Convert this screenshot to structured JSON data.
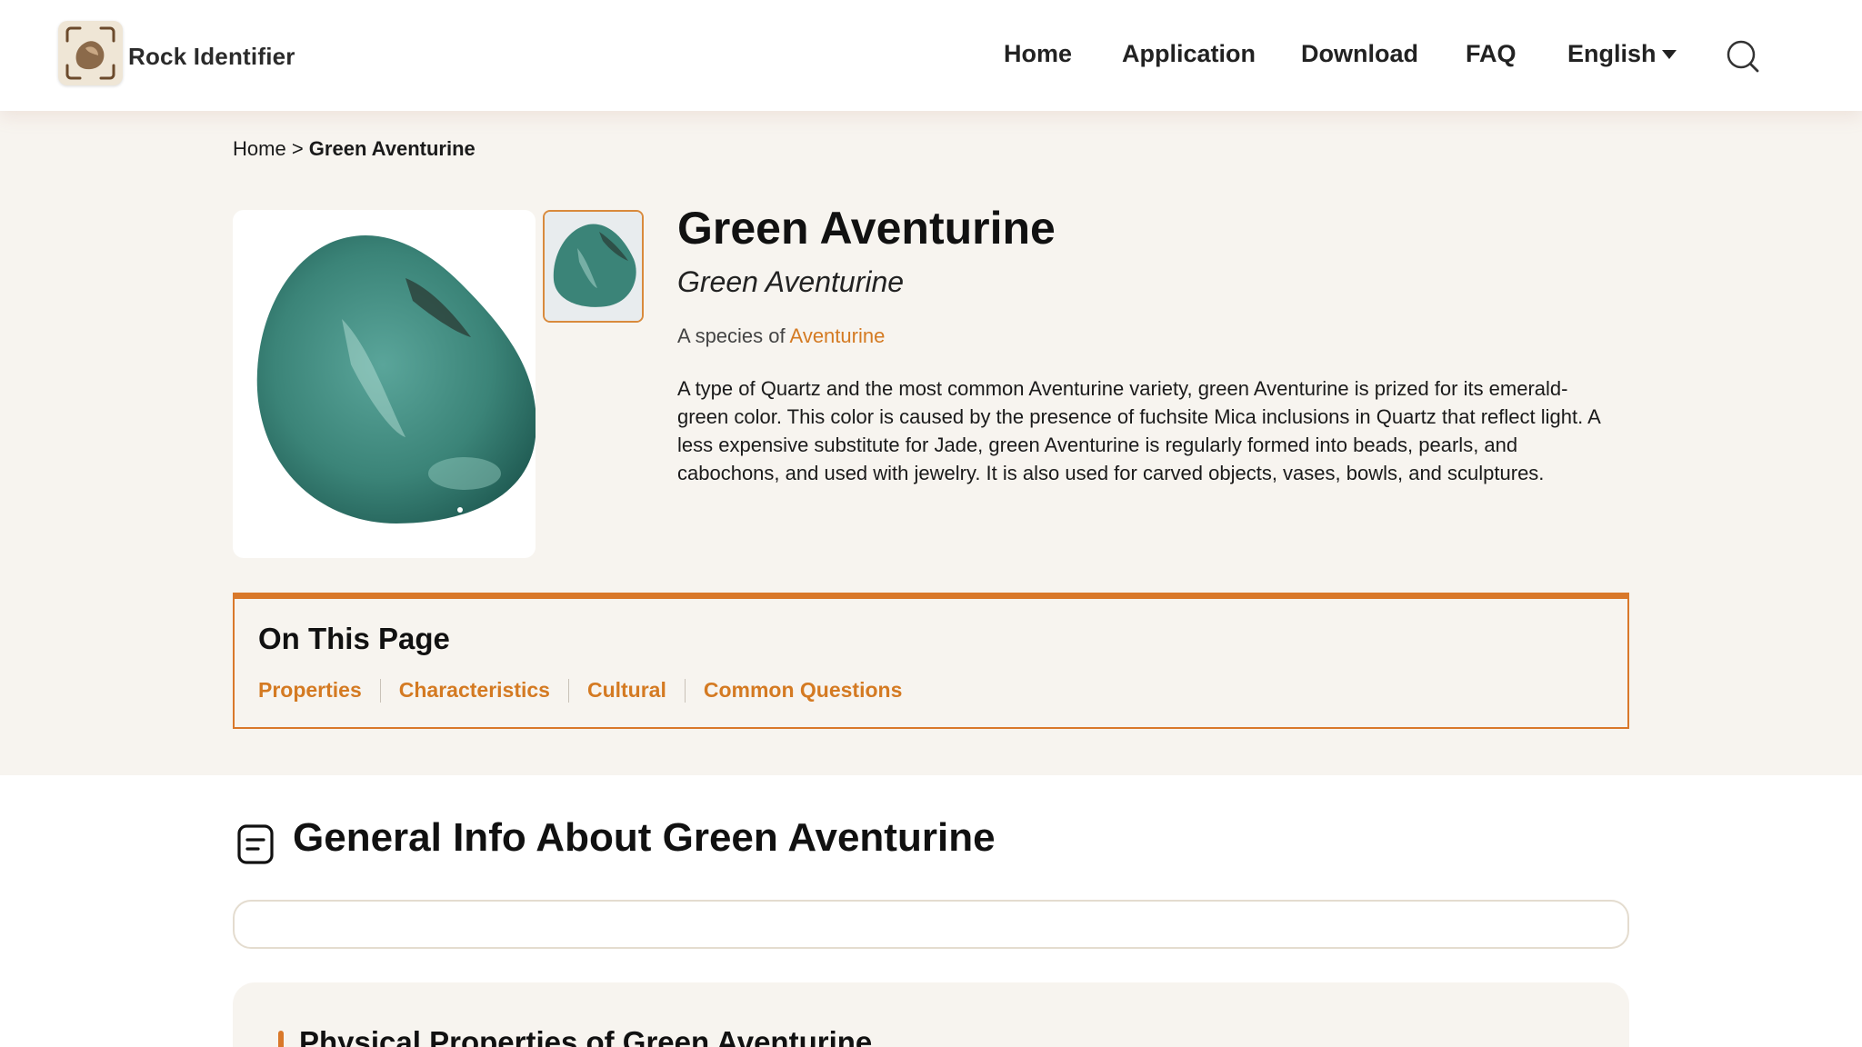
{
  "header": {
    "brand": "Rock Identifier",
    "nav": {
      "home": "Home",
      "application": "Application",
      "download": "Download",
      "faq": "FAQ",
      "language": "English"
    }
  },
  "breadcrumb": {
    "home": "Home",
    "separator": ">",
    "current": "Green Aventurine"
  },
  "specimen": {
    "title": "Green Aventurine",
    "subtitle": "Green Aventurine",
    "species_prefix": "A species of",
    "species_link": "Aventurine",
    "description": "A type of Quartz and the most common Aventurine variety, green Aventurine is prized for its emerald-green color. This color is caused by the presence of fuchsite Mica inclusions in Quartz that reflect light. A less expensive substitute for Jade, green Aventurine is regularly formed into beads, pearls, and cabochons, and used with jewelry. It is also used for carved objects, vases, bowls, and sculptures."
  },
  "toc": {
    "title": "On This Page",
    "links": [
      "Properties",
      "Characteristics",
      "Cultural",
      "Common Questions"
    ]
  },
  "general": {
    "title": "General Info About Green Aventurine"
  },
  "physical": {
    "title": "Physical Properties of Green Aventurine"
  },
  "colors": {
    "accent": "#d9782a",
    "link": "#d47a22",
    "band_bg": "#f7f4ef",
    "stone": "#3f8a7e"
  },
  "icons": {
    "logo": "rock-identifier-logo-icon",
    "search": "search-icon",
    "language_caret": "caret-down-icon",
    "general_info": "document-icon"
  }
}
